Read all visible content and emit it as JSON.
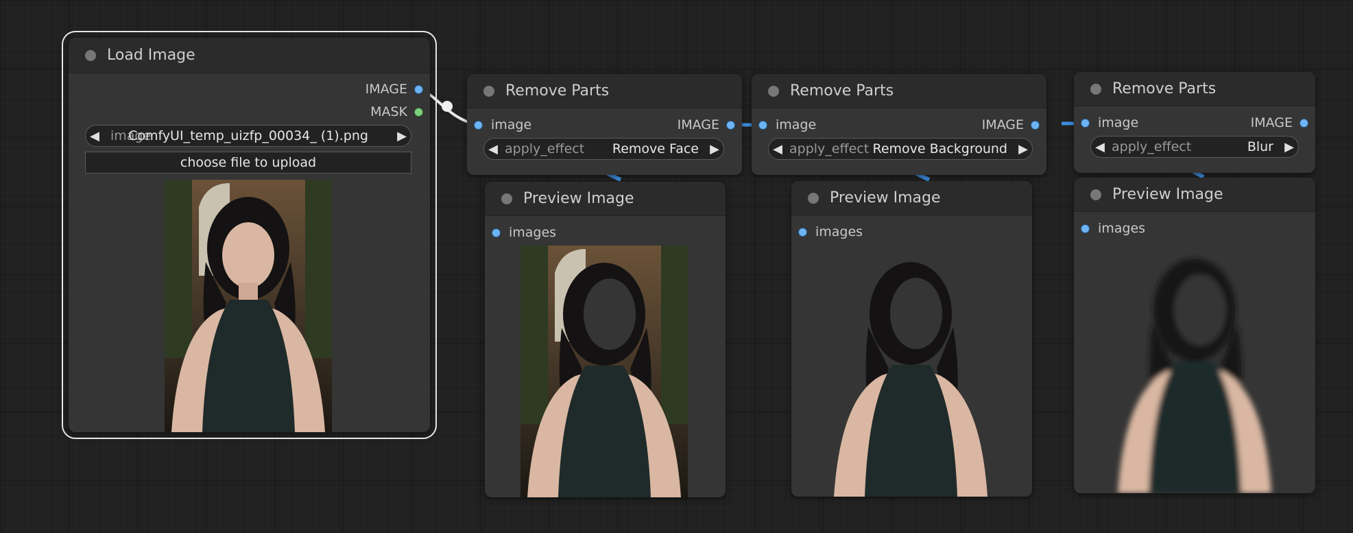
{
  "load_image": {
    "title": "Load Image",
    "outputs": [
      "IMAGE",
      "MASK"
    ],
    "image_widget": {
      "label": "image",
      "value": "ComfyUI_temp_uizfp_00034_ (1).png"
    },
    "upload_label": "choose file to upload"
  },
  "remove_parts": [
    {
      "title": "Remove Parts",
      "input": "image",
      "output": "IMAGE",
      "effect_label": "apply_effect",
      "effect_value": "Remove Face"
    },
    {
      "title": "Remove Parts",
      "input": "image",
      "output": "IMAGE",
      "effect_label": "apply_effect",
      "effect_value": "Remove Background"
    },
    {
      "title": "Remove Parts",
      "input": "image",
      "output": "IMAGE",
      "effect_label": "apply_effect",
      "effect_value": "Blur"
    }
  ],
  "preview_image": [
    {
      "title": "Preview Image",
      "input": "images"
    },
    {
      "title": "Preview Image",
      "input": "images"
    },
    {
      "title": "Preview Image",
      "input": "images"
    }
  ],
  "colors": {
    "canvas": "#202020",
    "node_body": "#353535",
    "node_title": "#2b2b2b",
    "image_pin": "#6cb4f5",
    "mask_pin": "#7ed07e"
  }
}
